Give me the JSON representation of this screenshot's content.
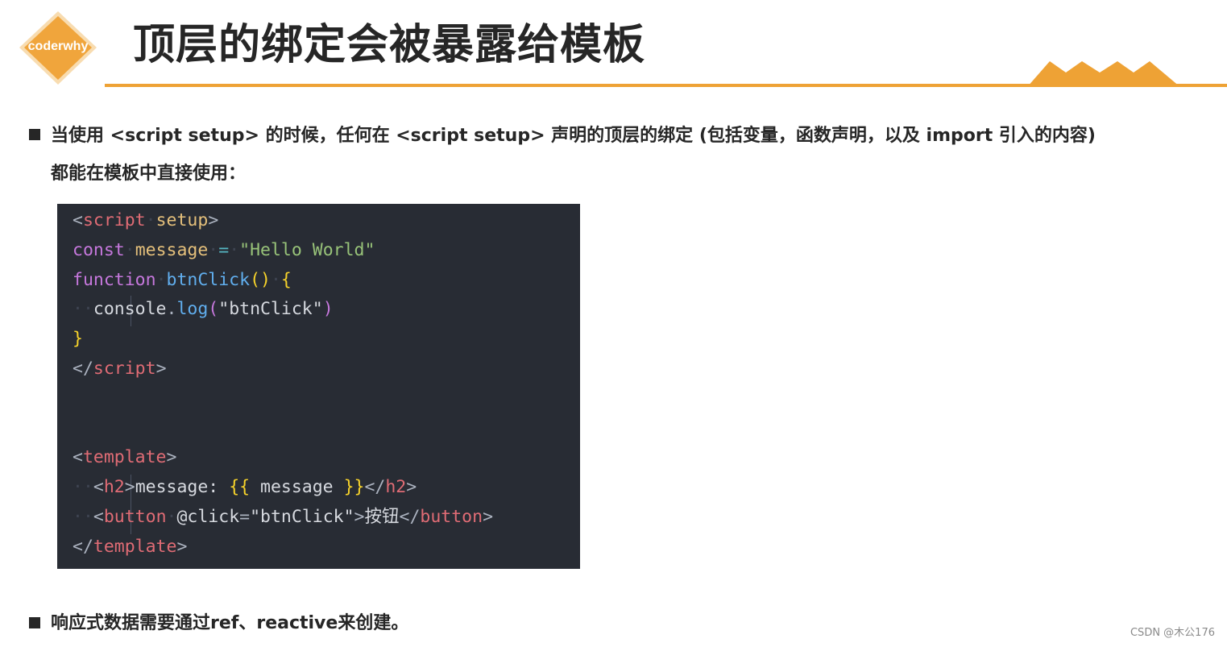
{
  "header": {
    "logo_text": "coderwhy",
    "title": "顶层的绑定会被暴露给模板"
  },
  "bullets": [
    {
      "line1": "当使用 <script setup> 的时候，任何在 <script setup> 声明的顶层的绑定 (包括变量，函数声明，以及 import 引入的内容)",
      "line2": "都能在模板中直接使用："
    },
    {
      "line1": "响应式数据需要通过ref、reactive来创建。"
    }
  ],
  "code": {
    "script_tag": "script",
    "setup_attr": "setup",
    "const_kw": "const",
    "message_var": "message",
    "assign_op": "=",
    "hello_str": "\"Hello World\"",
    "function_kw": "function",
    "btnclick_fn": "btnClick",
    "console_obj": "console",
    "log_fn": "log",
    "btnclick_str": "\"btnClick\"",
    "template_tag": "template",
    "h2_tag": "h2",
    "h2_text": "message: ",
    "mustache_open": "{{",
    "mustache_var": " message ",
    "mustache_close": "}}",
    "button_tag": "button",
    "click_attr": "@click",
    "click_value": "\"btnClick\"",
    "button_text": "按钮"
  },
  "watermark": "CSDN @木公176",
  "colors": {
    "accent": "#eea235",
    "code_bg": "#282c34"
  }
}
